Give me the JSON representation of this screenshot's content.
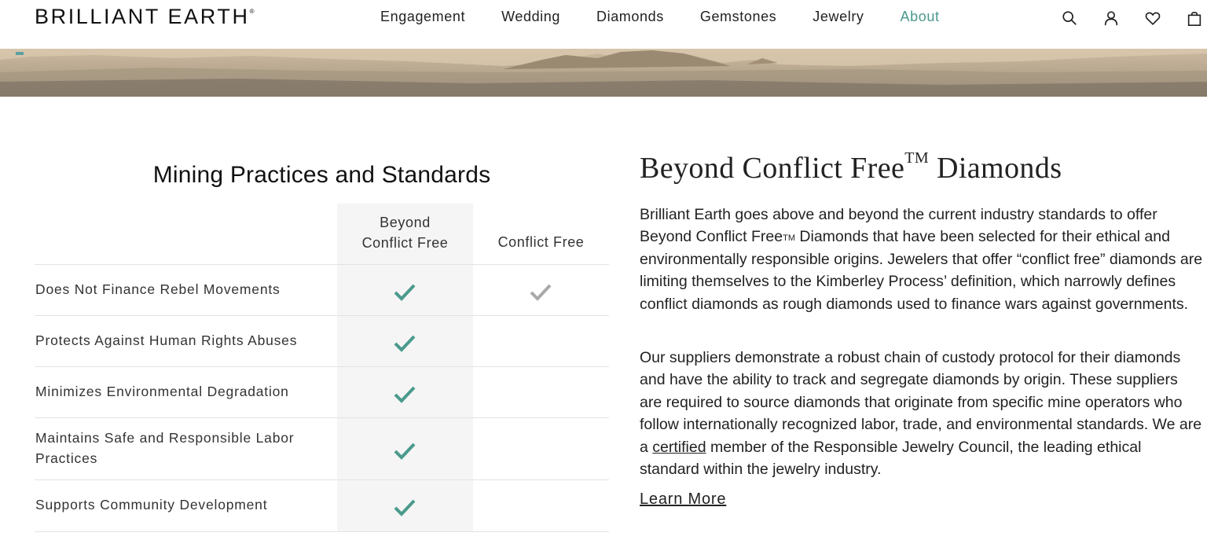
{
  "header": {
    "logo": "BRILLIANT EARTH",
    "logo_mark": "®",
    "nav": [
      {
        "label": "Engagement"
      },
      {
        "label": "Wedding"
      },
      {
        "label": "Diamonds"
      },
      {
        "label": "Gemstones"
      },
      {
        "label": "Jewelry"
      },
      {
        "label": "About"
      }
    ],
    "active_nav": "About",
    "icons": [
      "search-icon",
      "account-icon",
      "heart-icon",
      "bag-icon"
    ]
  },
  "table": {
    "title": "Mining Practices and Standards",
    "columns": [
      "Beyond Conflict Free",
      "Conflict Free"
    ],
    "rows": [
      {
        "label": "Does Not Finance Rebel Movements",
        "beyond_conflict_free": true,
        "conflict_free": true
      },
      {
        "label": "Protects Against Human Rights Abuses",
        "beyond_conflict_free": true,
        "conflict_free": false
      },
      {
        "label": "Minimizes Environmental Degradation",
        "beyond_conflict_free": true,
        "conflict_free": false
      },
      {
        "label": "Maintains Safe and Responsible Labor Practices",
        "beyond_conflict_free": true,
        "conflict_free": false
      },
      {
        "label": "Supports Community Development",
        "beyond_conflict_free": true,
        "conflict_free": false
      }
    ]
  },
  "article": {
    "heading_main": "Beyond Conflict Free",
    "heading_tm": "TM",
    "heading_end": " Diamonds",
    "p1_a": "Brilliant Earth goes above and beyond the current industry standards to offer Beyond Conflict Free",
    "p1_tm": "TM",
    "p1_b": " Diamonds that have been selected for their ethical and environmentally responsible origins. Jewelers that offer “conflict free” diamonds are limiting themselves to the Kimberley Process’ definition, which narrowly defines conflict diamonds as rough diamonds used to finance wars against governments.",
    "p2_a": "Our suppliers demonstrate a robust chain of custody protocol for their diamonds and have the ability to track and segregate diamonds by origin. These suppliers are required to source diamonds that originate from specific mine operators who follow internationally recognized labor, trade, and environmental standards. We are a ",
    "p2_link": "certified",
    "p2_b": " member of the Responsible Jewelry Council, the leading ethical standard within the jewelry industry.",
    "learn_more": "Learn More"
  },
  "colors": {
    "accent": "#4a9a8d",
    "check_primary": "#4a9a8d",
    "check_secondary": "#a9a9a9",
    "column_shade": "#f5f5f5"
  }
}
